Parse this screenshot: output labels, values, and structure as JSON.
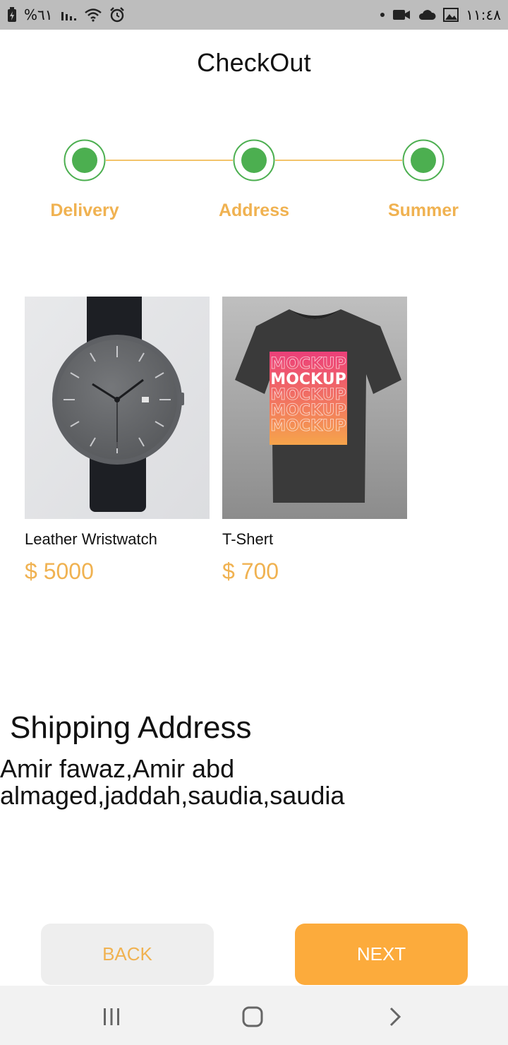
{
  "status_bar": {
    "battery_text": "%٦١",
    "time": "١١:٤٨"
  },
  "header": {
    "title": "CheckOut"
  },
  "stepper": {
    "steps": [
      {
        "label": "Delivery"
      },
      {
        "label": "Address"
      },
      {
        "label": "Summer"
      }
    ],
    "line_color": "#f3c46b",
    "active_color": "#4caf50"
  },
  "products": [
    {
      "name": "Leather Wristwatch",
      "price": "$ 5000",
      "image": "watch"
    },
    {
      "name": "T-Shert",
      "price": "$ 700",
      "image": "tshirt"
    }
  ],
  "shipping": {
    "title": "Shipping Address",
    "address": "Amir fawaz,Amir abd almaged,jaddah,saudia,saudia"
  },
  "buttons": {
    "back_label": "BACK",
    "next_label": "NEXT"
  },
  "mockup_text": {
    "label": "MOCKUP"
  },
  "colors": {
    "accent": "#f0b251",
    "next_button": "#fcab3c",
    "step_green": "#4caf50"
  }
}
